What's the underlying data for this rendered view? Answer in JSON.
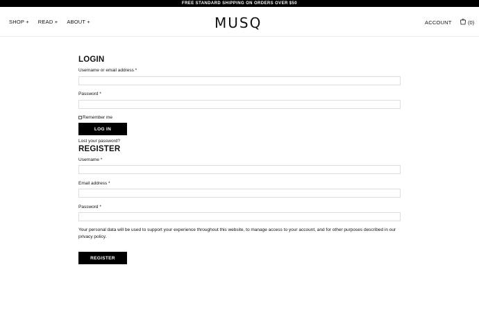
{
  "topbar": {
    "text": "FREE STANDARD SHIPPING ON ORDERS OVER $50"
  },
  "header": {
    "nav": [
      "SHOP +",
      "READ +",
      "ABOUT +"
    ],
    "logo": "MUSQ",
    "account": "ACCOUNT",
    "cart_count": "(0)"
  },
  "login": {
    "title": "LOGIN",
    "username_label": "Username or email address *",
    "password_label": "Password *",
    "remember_label": "Remember me",
    "submit": "LOG IN",
    "lost_password": "Lost your password?"
  },
  "register": {
    "title": "REGISTER",
    "username_label": "Username *",
    "email_label": "Email address *",
    "password_label": "Password *",
    "privacy_text": "Your personal data will be used to support your experience throughout this website, to manage access to your account, and for other purposes described in our privacy policy.",
    "submit": "REGISTER"
  },
  "icons": {
    "cart": "shopping-bag-icon"
  }
}
